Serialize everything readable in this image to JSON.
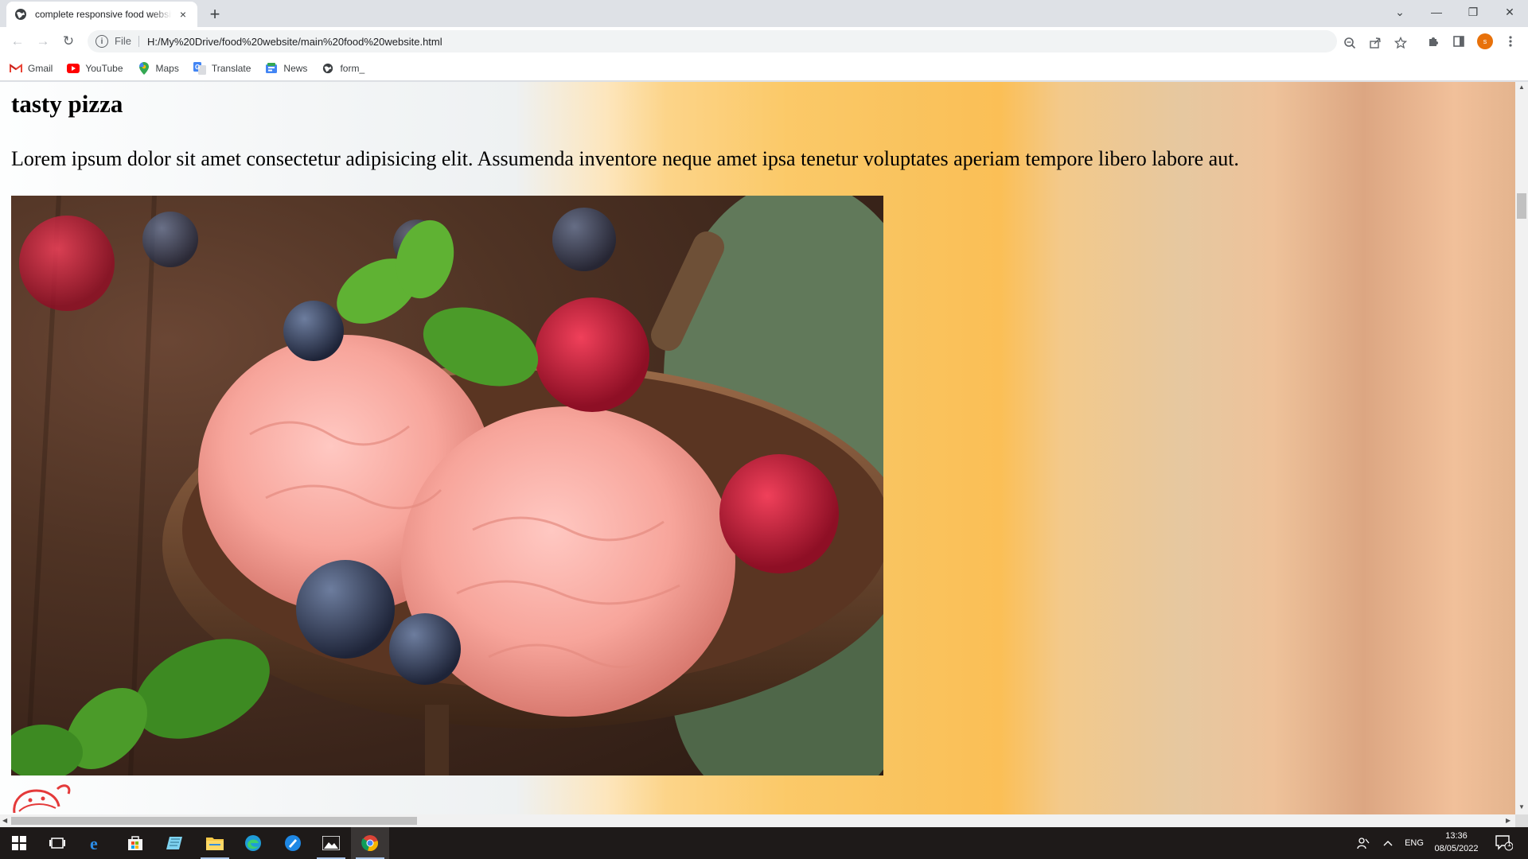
{
  "browser": {
    "tab": {
      "title": "complete responsive food website",
      "favicon": "globe-icon",
      "close": "×"
    },
    "new_tab": "+",
    "window_controls": {
      "tab_search": "⌄",
      "minimize": "—",
      "restore": "❐",
      "close": "✕"
    },
    "toolbar": {
      "back": "←",
      "forward": "→",
      "reload": "↻",
      "info": "i",
      "file_label": "File",
      "url": "H:/My%20Drive/food%20website/main%20food%20website.html",
      "profile_initial": "s"
    },
    "bookmarks": [
      {
        "label": "Gmail",
        "icon": "gmail-icon",
        "glyph": "M",
        "color": "#ea4335"
      },
      {
        "label": "YouTube",
        "icon": "youtube-icon",
        "glyph": "▶",
        "color": "#ff0000"
      },
      {
        "label": "Maps",
        "icon": "maps-icon",
        "glyph": "⬤",
        "color": "#34a853"
      },
      {
        "label": "Translate",
        "icon": "translate-icon",
        "glyph": "G",
        "color": "#4285f4"
      },
      {
        "label": "News",
        "icon": "news-icon",
        "glyph": "N",
        "color": "#4285f4"
      },
      {
        "label": "form_",
        "icon": "globe-icon",
        "glyph": "◉",
        "color": "#5f6368"
      }
    ]
  },
  "page": {
    "heading": "tasty pizza",
    "paragraph": "Lorem ipsum dolor sit amet consectetur adipisicing elit. Assumenda inventore neque amet ipsa tenetur voluptates aperiam tempore libero labore aut.",
    "image": "ice-cream-bowl-photo"
  },
  "taskbar": {
    "items": [
      "windows-start-icon",
      "task-view-icon",
      "internet-explorer-icon",
      "store-icon",
      "notepad-icon",
      "file-explorer-icon",
      "edge-icon",
      "photos-app-icon",
      "photos-icon",
      "chrome-icon"
    ],
    "tray": {
      "language": "ENG",
      "time": "13:36",
      "date": "08/05/2022",
      "notifications": "1"
    }
  }
}
